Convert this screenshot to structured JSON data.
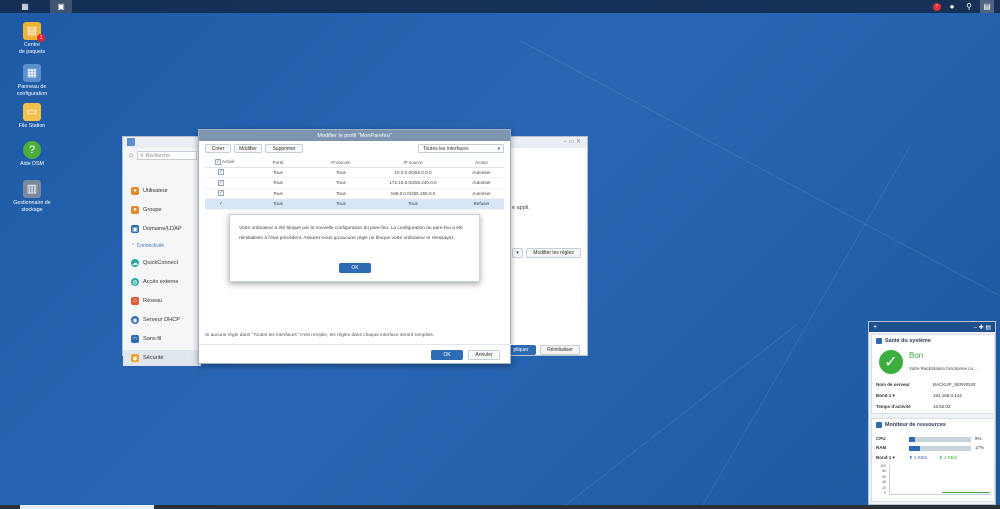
{
  "desktop": {
    "icons": [
      {
        "label_line1": "Centre",
        "label_line2": "de paquets",
        "icon": "package-center-icon"
      },
      {
        "label_line1": "Panneau de",
        "label_line2": "configuration",
        "icon": "control-panel-icon"
      },
      {
        "label_line1": "File Station",
        "label_line2": "",
        "icon": "file-station-icon"
      },
      {
        "label_line1": "Aide DSM",
        "label_line2": "",
        "icon": "help-icon"
      },
      {
        "label_line1": "Gestionnaire de",
        "label_line2": "stockage",
        "icon": "storage-manager-icon"
      }
    ],
    "package_badge": "1"
  },
  "control_panel": {
    "search_placeholder": "Recherche",
    "sidebar": {
      "items_top": [
        {
          "label": "Utilisateur",
          "icon": "user-icon"
        },
        {
          "label": "Groupe",
          "icon": "group-icon"
        },
        {
          "label": "Domaine/LDAP",
          "icon": "domain-icon"
        }
      ],
      "section": "Connectivité",
      "items_conn": [
        {
          "label": "QuickConnect",
          "icon": "quickconnect-icon"
        },
        {
          "label": "Accès externe",
          "icon": "globe-icon"
        },
        {
          "label": "Réseau",
          "icon": "network-icon"
        },
        {
          "label": "Serveur DHCP",
          "icon": "dhcp-icon"
        },
        {
          "label": "Sans fil",
          "icon": "wifi-icon"
        },
        {
          "label": "Sécurité",
          "icon": "shield-icon"
        }
      ]
    },
    "partial_text": "e appli.",
    "edit_rules_label": "Modifier les règles",
    "apply_label": "pliquer",
    "reset_label": "Réinitialiser"
  },
  "dialog": {
    "title": "Modifier le profil \"MonParefeu\"",
    "buttons": {
      "create": "Créer",
      "edit": "Modifier",
      "delete": "Supprimer"
    },
    "interface_select": "Toutes les interfaces",
    "columns": [
      "Activé",
      "Ports",
      "Protocole",
      "IP source",
      "Action"
    ],
    "rows": [
      {
        "ports": "Tous",
        "protocol": "Tous",
        "source_ip": "10.0.0.0/255.0.0.0",
        "action": "Autoriser"
      },
      {
        "ports": "Tous",
        "protocol": "Tous",
        "source_ip": "172.16.0.0/255.240.0.0",
        "action": "Autoriser"
      },
      {
        "ports": "Tous",
        "protocol": "Tous",
        "source_ip": "168.0.0.0/255.255.0.0",
        "action": "Autoriser"
      },
      {
        "ports": "Tous",
        "protocol": "Tous",
        "source_ip": "Tous",
        "action": "Refuser"
      }
    ],
    "footer_note": "Si aucune règle dans \"Toutes les interfaces\" n'est remplie, les règles dans chaque interface seront remplies.",
    "ok_label": "OK",
    "cancel_label": "Annuler"
  },
  "alert": {
    "message": "Votre ordinateur a été bloqué par la nouvelle configuration du pare-feu. La configuration du pare-feu a été réinitialisée à l'état précédent. Assurez-vous qu'aucune règle ne bloque votre ordinateur et réessayez.",
    "ok_label": "OK"
  },
  "widgets": {
    "health": {
      "title": "Santé du système",
      "status": "Bon",
      "subtitle": "Votre RackStation fonctionne co...",
      "server_name_label": "Nom de serveur",
      "server_name": "BACKUP_SERVEUR",
      "bond_label": "Bond 1 ▾",
      "bond_ip": "192.168.0.144",
      "uptime_label": "Temps d'activité",
      "uptime": "16:52:02"
    },
    "resources": {
      "title": "Moniteur de ressources",
      "cpu_label": "CPU",
      "cpu_value": "9%",
      "cpu_fraction": 0.09,
      "ram_label": "RAM",
      "ram_value": "17%",
      "ram_fraction": 0.17,
      "bond_label": "Bond 1 ▾",
      "upload": "1 KB/s",
      "download": "1 KB/s",
      "chart_ticks": [
        "100",
        "80",
        "60",
        "40",
        "20",
        "0"
      ]
    }
  },
  "colors": {
    "accent": "#2d6bb5",
    "desktop": "#1f5ca6",
    "ok_green": "#3dae3d"
  }
}
